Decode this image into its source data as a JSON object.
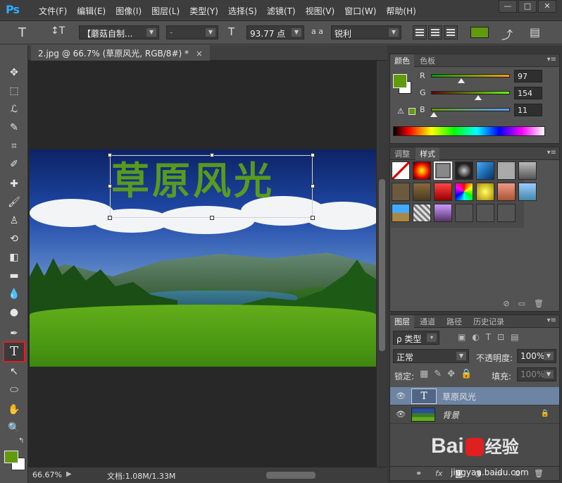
{
  "app": {
    "logo": "Ps",
    "menu": [
      "文件(F)",
      "编辑(E)",
      "图像(I)",
      "图层(L)",
      "类型(Y)",
      "选择(S)",
      "滤镜(T)",
      "视图(V)",
      "窗口(W)",
      "帮助(H)"
    ],
    "window_controls": [
      "—",
      "□",
      "✕"
    ]
  },
  "options_bar": {
    "tool_glyph": "T",
    "orient_glyph": "↕T",
    "font_family": "【蘑菇自制...",
    "font_style": "-",
    "size_glyph": "T",
    "font_size": "93.77 点",
    "aa_glyph": "a a",
    "antialias": "锐利",
    "text_color": "#619a0b",
    "warp_glyph": "⤴",
    "panel_glyph": "▤"
  },
  "document": {
    "tab_title": "2.jpg @ 66.7% (草原风光, RGB/8#) *",
    "tab_close": "×",
    "text_content": "草原风光",
    "zoom": "66.67%",
    "doc_info": "文档:1.08M/1.33M",
    "status_arrow": "▶"
  },
  "tools": {
    "items": [
      "✥",
      "⬚",
      "ℒ",
      "✎",
      "⌗",
      "✐",
      "✚",
      "🖌",
      "♙",
      "⟲",
      "◧",
      "▬",
      "💧",
      "●",
      "✒",
      "T",
      "↖",
      "⬭",
      "✋",
      "🔍"
    ],
    "fg_color": "#619a0b",
    "bg_color": "#ffffff",
    "swap_glyph": "↰"
  },
  "color_panel": {
    "tabs": [
      "颜色",
      "色板"
    ],
    "fg": "#619a0b",
    "channels": [
      {
        "label": "R",
        "value": "97",
        "fraction": 0.38
      },
      {
        "label": "G",
        "value": "154",
        "fraction": 0.6
      },
      {
        "label": "B",
        "value": "11",
        "fraction": 0.04
      }
    ],
    "warning_glyph": "⚠"
  },
  "styles_panel": {
    "tabs": [
      "调整",
      "样式"
    ]
  },
  "layers_panel": {
    "tabs": [
      "图层",
      "通道",
      "路径",
      "历史记录"
    ],
    "filter_label": "ρ 类型",
    "blend_mode": "正常",
    "opacity_label": "不透明度:",
    "opacity_value": "100%",
    "lock_label": "锁定:",
    "fill_label": "填充:",
    "fill_value": "100%",
    "layers": [
      {
        "name": "草原风光",
        "thumb": "T",
        "type": "text",
        "selected": true
      },
      {
        "name": "背景",
        "thumb": "",
        "type": "image",
        "selected": false,
        "locked": true
      }
    ],
    "lock_icon": "🔒",
    "footer_icons": [
      "⚭",
      "fx",
      "◙",
      "◑",
      "▭",
      "⧉",
      "🗑"
    ]
  },
  "watermark": {
    "brand": "Bai",
    "brand_cn": "经验",
    "url": "jingyan.baidu.com"
  }
}
